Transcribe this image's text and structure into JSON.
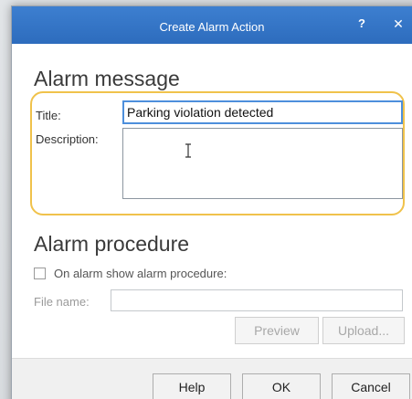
{
  "window": {
    "title": "Create Alarm Action",
    "help_symbol": "?",
    "close_symbol": "✕"
  },
  "alarm_message": {
    "heading": "Alarm message",
    "title_label": "Title:",
    "title_value": "Parking violation detected",
    "description_label": "Description:",
    "description_value": ""
  },
  "alarm_procedure": {
    "heading": "Alarm procedure",
    "checkbox_label": "On alarm show alarm procedure:",
    "checkbox_checked": false,
    "file_name_label": "File name:",
    "file_name_value": "",
    "preview_label": "Preview",
    "upload_label": "Upload..."
  },
  "footer": {
    "help_label": "Help",
    "ok_label": "OK",
    "cancel_label": "Cancel"
  },
  "colors": {
    "titlebar": "#2d6cbd",
    "highlight": "#f0c24b",
    "active_input_border": "#4d8fdc"
  },
  "icons": {
    "text_cursor": "ibeam-cursor-icon"
  }
}
